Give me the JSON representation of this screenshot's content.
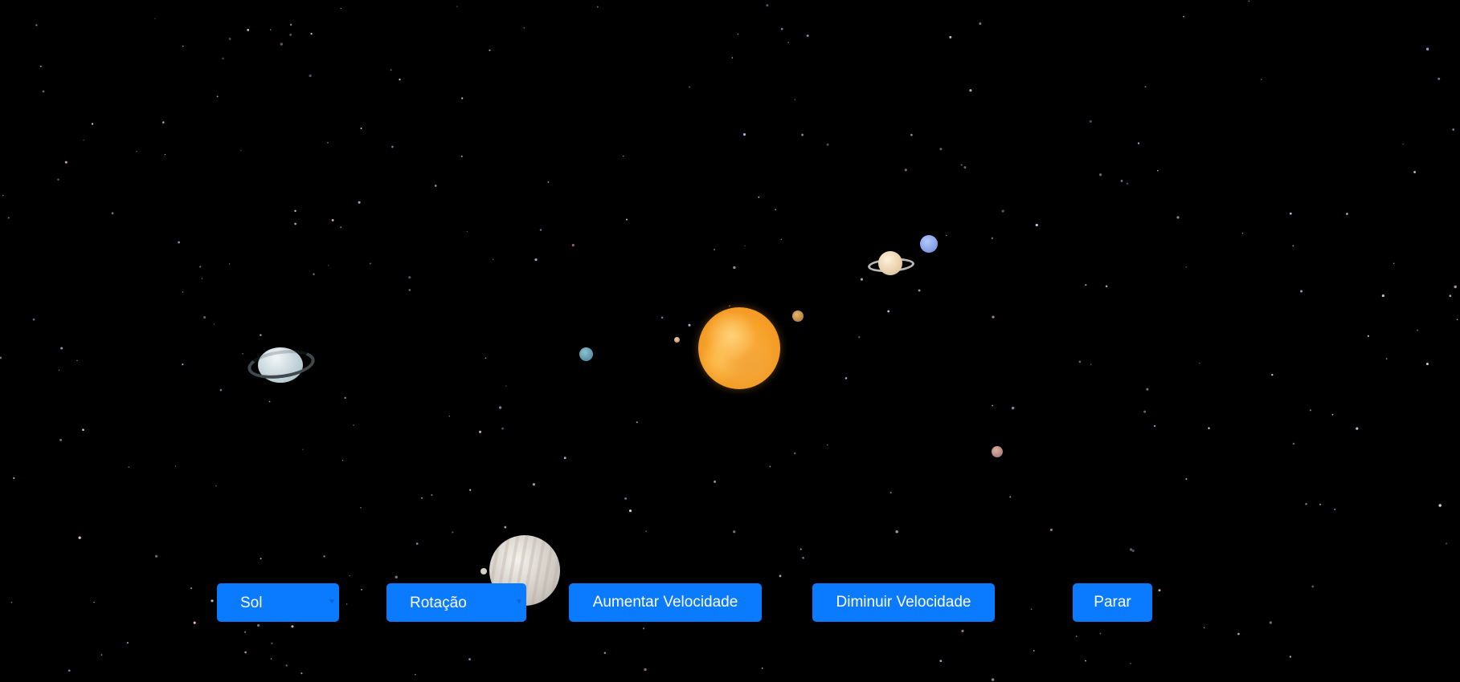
{
  "scene": {
    "background": "#000000",
    "star_count": 260,
    "bodies": [
      "Sol",
      "Mercúrio",
      "Vênus",
      "Terra",
      "Marte",
      "Júpiter",
      "Saturno",
      "Urano",
      "Netuno"
    ]
  },
  "controls": {
    "body_select": {
      "value": "Sol",
      "options": [
        "Sol"
      ]
    },
    "mode_select": {
      "value": "Rotação",
      "options": [
        "Rotação"
      ]
    },
    "increase_speed_label": "Aumentar Velocidade",
    "decrease_speed_label": "Diminuir Velocidade",
    "stop_label": "Parar",
    "accent": "#0a7bff",
    "text_color": "#ffffff"
  }
}
